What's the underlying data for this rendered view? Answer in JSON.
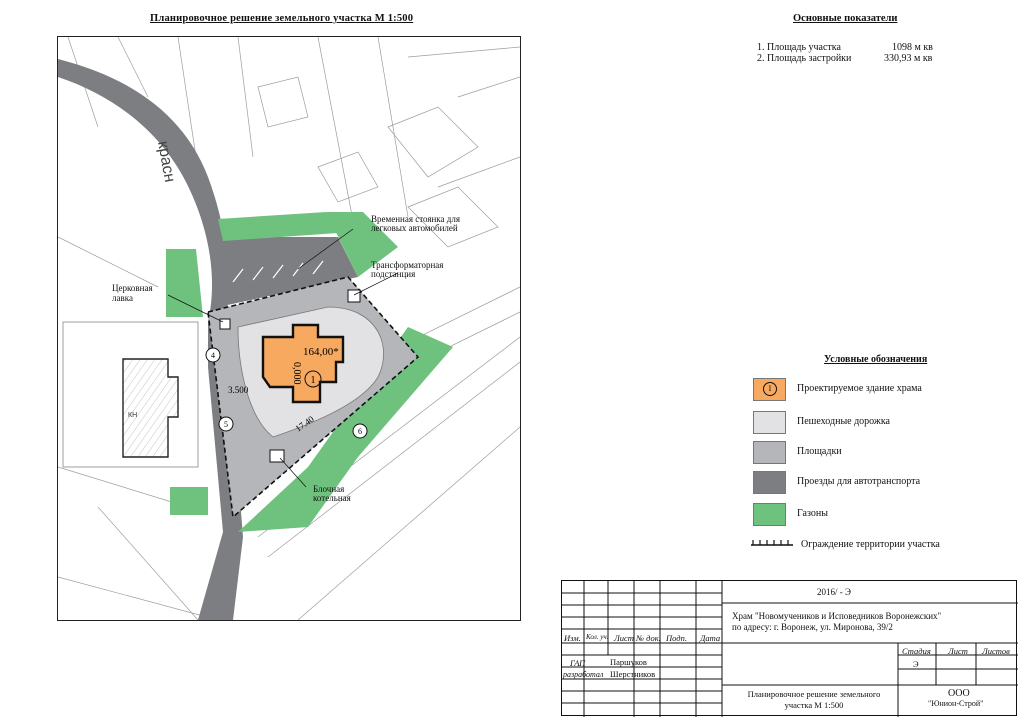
{
  "plan_title": "Планировочное решение земельного участка  М 1:500",
  "indicators": {
    "title": "Основные показатели",
    "rows": [
      {
        "label": "1. Площадь участка",
        "value": "1098 м кв"
      },
      {
        "label": "2. Площадь застройки",
        "value": "330,93 м кв"
      }
    ]
  },
  "map_labels": {
    "street": "красн",
    "parking": "Временная стоянка для легковых автомобилей",
    "transformer": "Трансформаторная подстанция",
    "shop": "Церковная лавка",
    "boiler": "Блочная котельная",
    "elevation": "164,00*",
    "zero": "0,000",
    "dim_left": "3.500",
    "dim_bottom": "17.40",
    "building_num": "1",
    "marker_4": "4",
    "marker_5": "5",
    "marker_6": "6",
    "kn": "КН"
  },
  "legend": {
    "title": "Условные обозначения",
    "items": [
      {
        "label": "Проектируемое здание храма",
        "color": "#f6a95f"
      },
      {
        "label": "Пешеходные дорожка",
        "color": "#e2e1e4"
      },
      {
        "label": "Площадки",
        "color": "#b4b6ba"
      },
      {
        "label": "Проезды для автотранспорта",
        "color": "#7c7e82"
      },
      {
        "label": "Газоны",
        "color": "#6fc27e"
      },
      {
        "label": "Ограждение территории участка",
        "color": "#111111"
      }
    ]
  },
  "stamp": {
    "code": "2016/ - Э",
    "object": "Храм \"Новомучеников и Исповедников Воронежских\"",
    "address": "по адресу: г. Воронеж, ул. Миронова, 39/2",
    "headers": [
      "Изм.",
      "Кол. уч.",
      "Лист",
      "№ док.",
      "Подп.",
      "Дата"
    ],
    "roles": [
      {
        "role": "ГАП",
        "name": "Паршуков"
      },
      {
        "role": "разработал",
        "name": "Шерстников"
      }
    ],
    "sheet_title": "Планировочное решение земельного участка  М 1:500",
    "stage_headers": [
      "Стадия",
      "Лист",
      "Листов"
    ],
    "stage": "Э",
    "org_form": "ООО",
    "org_name": "\"Юнион-Строй\""
  }
}
